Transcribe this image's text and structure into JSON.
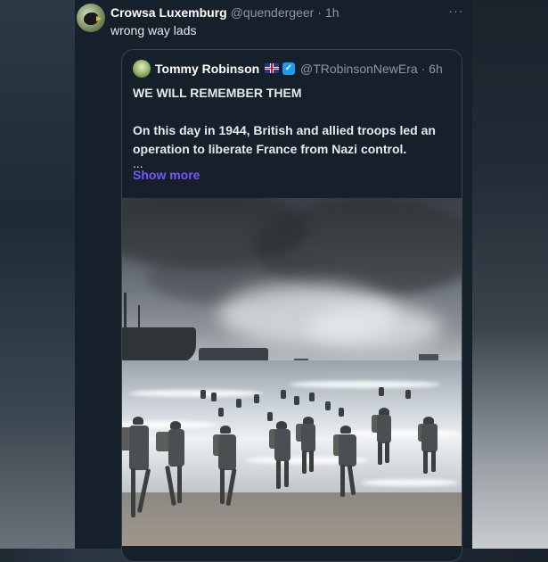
{
  "post": {
    "display_name": "Crowsa Luxemburg",
    "handle": "@quendergeer",
    "separator": "·",
    "time": "1h",
    "more": "···",
    "text": "wrong way lads"
  },
  "quote": {
    "display_name": "Tommy Robinson",
    "verified_mark": "✓",
    "handle": "@TRobinsonNewEra",
    "separator": "·",
    "time": "6h",
    "title": "WE WILL REMEMBER THEM",
    "body": "On this day in 1944, British and allied troops led an operation to liberate France from Nazi control.",
    "ellipsis": "...",
    "show_more": "Show more"
  },
  "colors": {
    "background": "#15202b",
    "text_primary": "#e7e9ea",
    "text_secondary": "#8b98a5",
    "link": "#7856ff",
    "verified": "#1d9bf0"
  }
}
